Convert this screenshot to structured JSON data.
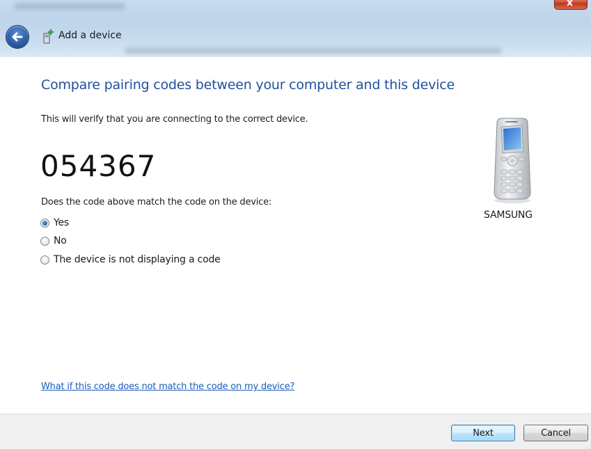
{
  "window": {
    "title": "Add a device",
    "close_glyph": "x"
  },
  "header": {
    "back_icon": "back-arrow-icon",
    "device_icon": "add-device-icon"
  },
  "content": {
    "heading": "Compare pairing codes between your computer and this device",
    "description": "This will verify that you are connecting to the correct device.",
    "code": "054367",
    "question": "Does the code above match the code on the device:",
    "options": [
      {
        "label": "Yes",
        "checked": true
      },
      {
        "label": "No",
        "checked": false
      },
      {
        "label": "The device is not displaying a code",
        "checked": false
      }
    ],
    "help_link": "What if this code does not match the code on my device?"
  },
  "device": {
    "name": "SAMSUNG",
    "icon": "mobile-phone-icon"
  },
  "footer": {
    "next_label": "Next",
    "cancel_label": "Cancel"
  },
  "colors": {
    "heading": "#1f4f9e",
    "link": "#1a5bb8",
    "default_button_border": "#3c7fb1"
  }
}
